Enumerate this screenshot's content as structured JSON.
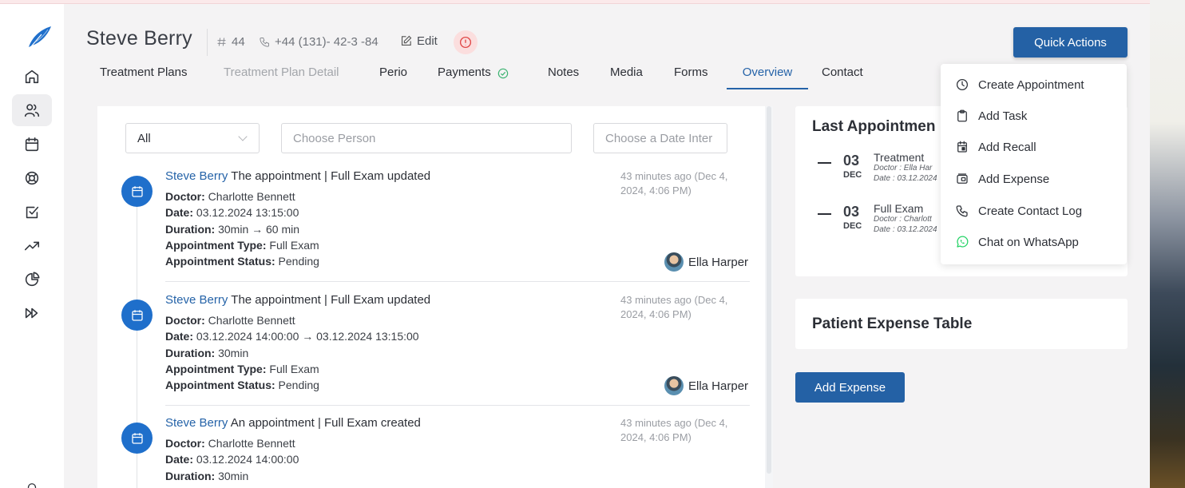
{
  "header": {
    "patient_name": "Steve Berry",
    "patient_id": "44",
    "phone": "+44 (131)- 42-3 -84",
    "edit_label": "Edit"
  },
  "tabs": [
    {
      "label": "Treatment Plans",
      "state": "normal"
    },
    {
      "label": "Treatment Plan Detail",
      "state": "disabled"
    },
    {
      "label": "Perio",
      "state": "normal"
    },
    {
      "label": "Payments",
      "state": "normal"
    },
    {
      "label": "Notes",
      "state": "normal"
    },
    {
      "label": "Media",
      "state": "normal"
    },
    {
      "label": "Forms",
      "state": "normal"
    },
    {
      "label": "Overview",
      "state": "active"
    },
    {
      "label": "Contact",
      "state": "normal"
    }
  ],
  "quick_actions": {
    "label": "Quick Actions",
    "items": [
      {
        "label": "Create Appointment",
        "icon": "clock-icon"
      },
      {
        "label": "Add Task",
        "icon": "clipboard-icon"
      },
      {
        "label": "Add Recall",
        "icon": "calendar-icon"
      },
      {
        "label": "Add Expense",
        "icon": "wallet-icon"
      },
      {
        "label": "Create Contact Log",
        "icon": "phone-icon"
      },
      {
        "label": "Chat on WhatsApp",
        "icon": "whatsapp-icon"
      }
    ]
  },
  "filters": {
    "type_value": "All",
    "person_placeholder": "Choose Person",
    "date_placeholder": "Choose a Date Inter"
  },
  "feed": [
    {
      "person": "Steve Berry",
      "action": "The appointment | Full Exam updated",
      "time": "43 minutes ago (Dec 4, 2024, 4:06 PM)",
      "details": [
        {
          "label": "Doctor:",
          "value": "Charlotte Bennett"
        },
        {
          "label": "Date:",
          "value": "03.12.2024 13:15:00"
        },
        {
          "label": "Duration:",
          "value": "30min → 60 min"
        },
        {
          "label": "Appointment Type:",
          "value": "Full Exam"
        },
        {
          "label": "Appointment Status:",
          "value": "Pending"
        }
      ],
      "author": "Ella Harper"
    },
    {
      "person": "Steve Berry",
      "action": "The appointment | Full Exam updated",
      "time": "43 minutes ago (Dec 4, 2024, 4:06 PM)",
      "details": [
        {
          "label": "Doctor:",
          "value": "Charlotte Bennett"
        },
        {
          "label": "Date:",
          "value": "03.12.2024 14:00:00 → 03.12.2024 13:15:00"
        },
        {
          "label": "Duration:",
          "value": "30min"
        },
        {
          "label": "Appointment Type:",
          "value": "Full Exam"
        },
        {
          "label": "Appointment Status:",
          "value": "Pending"
        }
      ],
      "author": "Ella Harper"
    },
    {
      "person": "Steve Berry",
      "action": "An appointment | Full Exam created",
      "time": "43 minutes ago (Dec 4, 2024, 4:06 PM)",
      "details": [
        {
          "label": "Doctor:",
          "value": "Charlotte Bennett"
        },
        {
          "label": "Date:",
          "value": "03.12.2024 14:00:00"
        },
        {
          "label": "Duration:",
          "value": "30min"
        }
      ],
      "author": ""
    }
  ],
  "last_appointments": {
    "title": "Last Appointmen",
    "items": [
      {
        "day": "03",
        "month": "DEC",
        "name": "Treatment",
        "doctor": "Doctor : Ella Har",
        "date": "Date : 03.12.2024"
      },
      {
        "day": "03",
        "month": "DEC",
        "name": "Full Exam",
        "doctor": "Doctor : Charlott",
        "date": "Date : 03.12.2024"
      }
    ]
  },
  "expense_table": {
    "title": "Patient Expense Table",
    "add_label": "Add Expense"
  },
  "colors": {
    "primary": "#2461a5",
    "link": "#2563a8",
    "timeline_icon": "#1f6fcb",
    "alert_bg": "#fbdede",
    "alert": "#e04848",
    "success": "#3cb371",
    "whatsapp": "#25d366"
  }
}
